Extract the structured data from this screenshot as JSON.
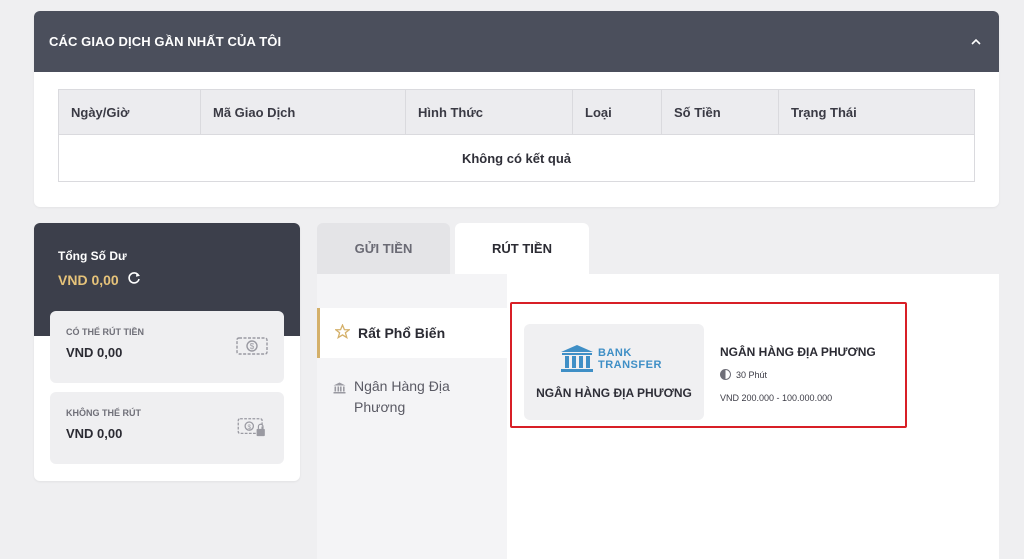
{
  "transactions": {
    "title": "CÁC GIAO DỊCH GẦN NHẤT CỦA TÔI",
    "collapse_icon": "chevron-up-icon",
    "columns": [
      "Ngày/Giờ",
      "Mã Giao Dịch",
      "Hình Thức",
      "Loại",
      "Số Tiền",
      "Trạng Thái"
    ],
    "empty_text": "Không có kết quả"
  },
  "balance": {
    "total_label": "Tổng Số Dư",
    "total_value": "VND  0,00",
    "withdrawable_label": "CÓ THỂ RÚT TIỀN",
    "withdrawable_value": "VND  0,00",
    "locked_label": "KHÔNG THỂ RÚT",
    "locked_value": "VND  0,00"
  },
  "tabs": {
    "deposit": "GỬI TIỀN",
    "withdraw": "RÚT TIỀN",
    "active": "withdraw"
  },
  "side_menu": {
    "popular": "Rất Phổ Biến",
    "local_bank": "Ngân Hàng Địa Phương"
  },
  "method": {
    "logo_top": "BANK",
    "logo_bottom": "TRANSFER",
    "logo_caption": "NGÂN HÀNG ĐỊA PHƯƠNG",
    "name": "NGÂN HÀNG ĐỊA PHƯƠNG",
    "time": "30 Phút",
    "range": "VND 200.000 - 100.000.000"
  },
  "colors": {
    "header_bg": "#4b4f5c",
    "balance_bg": "#3c3f4b",
    "gold": "#e6c37a",
    "highlight_border": "#d81f26",
    "logo_blue": "#3f8fc6"
  }
}
